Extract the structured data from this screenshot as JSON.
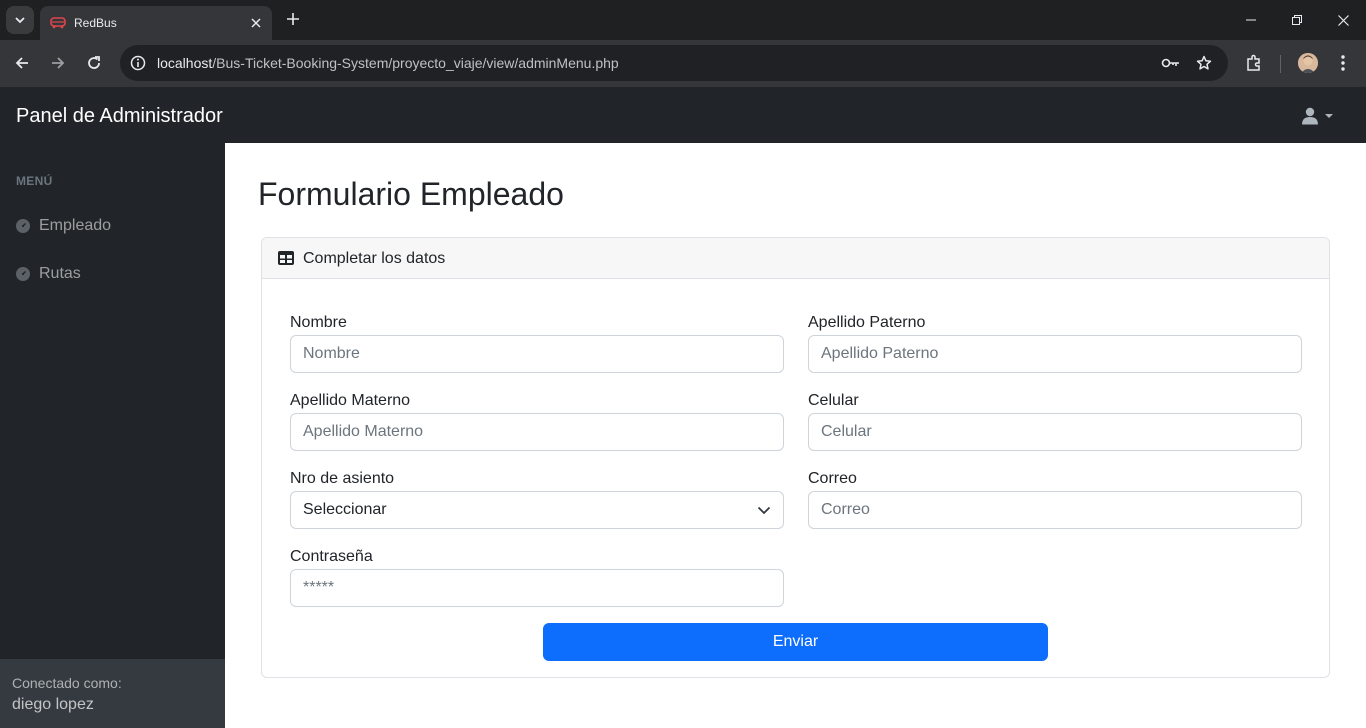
{
  "browser": {
    "tab_title": "RedBus",
    "url_host": "localhost",
    "url_path": "/Bus-Ticket-Booking-System/proyecto_viaje/view/adminMenu.php"
  },
  "navbar": {
    "brand": "Panel de Administrador",
    "user_icon": "user-icon"
  },
  "sidebar": {
    "heading": "MENÚ",
    "items": [
      {
        "label": "Empleado",
        "icon": "gauge-icon"
      },
      {
        "label": "Rutas",
        "icon": "gauge-icon"
      }
    ],
    "footer_label": "Conectado como:",
    "footer_user": "diego lopez"
  },
  "main": {
    "title": "Formulario Empleado",
    "card_header": "Completar los datos",
    "fields": {
      "nombre": {
        "label": "Nombre",
        "placeholder": "Nombre"
      },
      "apellido_paterno": {
        "label": "Apellido Paterno",
        "placeholder": "Apellido Paterno"
      },
      "apellido_materno": {
        "label": "Apellido Materno",
        "placeholder": "Apellido Materno"
      },
      "celular": {
        "label": "Celular",
        "placeholder": "Celular"
      },
      "nro_asiento": {
        "label": "Nro de asiento",
        "selected": "Seleccionar"
      },
      "correo": {
        "label": "Correo",
        "placeholder": "Correo"
      },
      "contrasena": {
        "label": "Contraseña",
        "placeholder": "*****"
      }
    },
    "submit_label": "Enviar"
  },
  "colors": {
    "primary": "#0d6efd",
    "dark": "#212529",
    "sidebar_footer": "#343a40"
  }
}
